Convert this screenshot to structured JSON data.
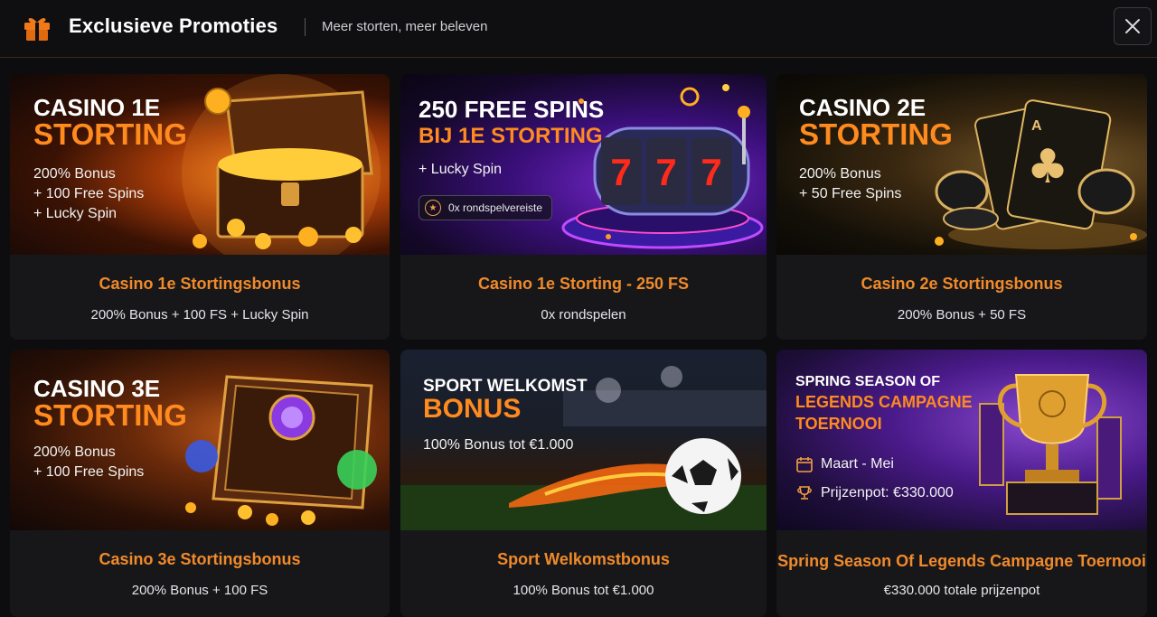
{
  "header": {
    "title": "Exclusieve Promoties",
    "subtitle": "Meer storten, meer beleven",
    "gift_icon": "gift-icon",
    "close_icon": "close-icon"
  },
  "colors": {
    "accent": "#f08a2a",
    "background": "#0d0d0f",
    "card": "#17171a"
  },
  "promotions": [
    {
      "banner": {
        "title_line1": "CASINO 1E",
        "title_line2": "STORTING",
        "lines": [
          "200% Bonus",
          "+ 100 Free Spins",
          "+ Lucky Spin"
        ],
        "art": "treasure-chest"
      },
      "name": "Casino 1e Stortingsbonus",
      "desc": "200% Bonus + 100 FS + Lucky Spin"
    },
    {
      "banner": {
        "title_line1": "250 FREE SPINS",
        "title_line2": "BIJ 1E STORTING",
        "lines": [
          "+ Lucky Spin"
        ],
        "pill": "0x rondspelvereiste",
        "art": "slot-machine"
      },
      "name": "Casino 1e Storting - 250 FS",
      "desc": "0x rondspelen"
    },
    {
      "banner": {
        "title_line1": "CASINO 2E",
        "title_line2": "STORTING",
        "lines": [
          "200% Bonus",
          "+ 50 Free Spins"
        ],
        "art": "playing-cards"
      },
      "name": "Casino 2e Stortingsbonus",
      "desc": "200% Bonus + 50 FS"
    },
    {
      "banner": {
        "title_line1": "CASINO 3E",
        "title_line2": "STORTING",
        "lines": [
          "200% Bonus",
          "+ 100 Free Spins"
        ],
        "art": "magic-book"
      },
      "name": "Casino 3e Stortingsbonus",
      "desc": "200% Bonus + 100 FS"
    },
    {
      "banner": {
        "title_line1": "SPORT WELKOMST",
        "title_line2": "BONUS",
        "lines": [
          "100% Bonus tot €1.000"
        ],
        "art": "football"
      },
      "name": "Sport Welkomstbonus",
      "desc": "100% Bonus tot €1.000"
    },
    {
      "banner": {
        "title_line1": "SPRING SEASON OF",
        "title_line2": "LEGENDS CAMPAGNE",
        "title_line3": "TOERNOOI",
        "dates": "Maart - Mei",
        "prize": "Prijzenpot: €330.000",
        "art": "trophy"
      },
      "name": "Spring Season Of Legends Campagne Toernooi",
      "desc": "€330.000 totale prijzenpot"
    }
  ]
}
